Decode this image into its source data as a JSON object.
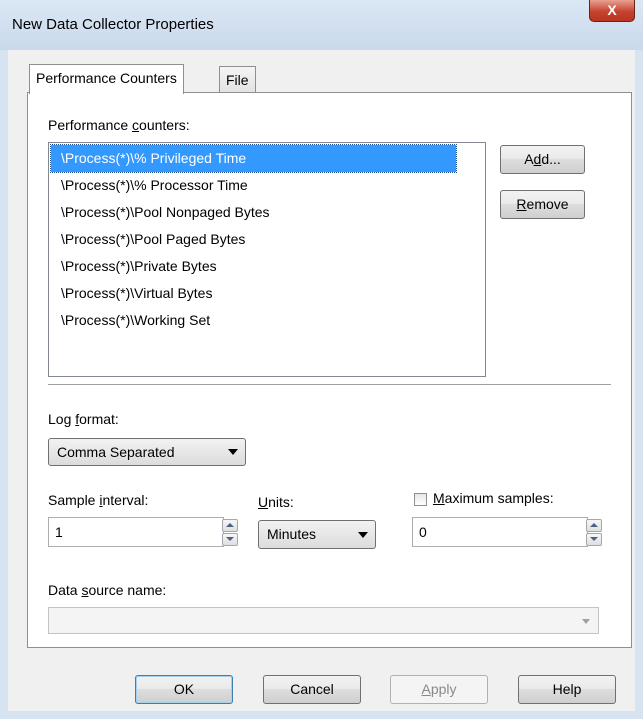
{
  "window": {
    "title": "New Data Collector Properties",
    "close_glyph": "X"
  },
  "tabs": [
    {
      "label": "Performance Counters",
      "active": true
    },
    {
      "label": "File",
      "active": false
    }
  ],
  "counters": {
    "label": "Performance counters:",
    "items": [
      "\\Process(*)\\% Privileged Time",
      "\\Process(*)\\% Processor Time",
      "\\Process(*)\\Pool Nonpaged Bytes",
      "\\Process(*)\\Pool Paged Bytes",
      "\\Process(*)\\Private Bytes",
      "\\Process(*)\\Virtual Bytes",
      "\\Process(*)\\Working Set"
    ],
    "selected_index": 0,
    "add_button": "Add...",
    "remove_button": "Remove"
  },
  "log_format": {
    "label": "Log format:",
    "value": "Comma Separated"
  },
  "sample_interval": {
    "label": "Sample interval:",
    "value": "1"
  },
  "units": {
    "label": "Units:",
    "value": "Minutes"
  },
  "maximum_samples": {
    "label": "Maximum samples:",
    "checked": false,
    "value": "0"
  },
  "data_source": {
    "label": "Data source name:",
    "value": ""
  },
  "footer": {
    "ok": "OK",
    "cancel": "Cancel",
    "apply": "Apply",
    "help": "Help"
  },
  "icons": {
    "close": "close-icon",
    "dropdown": "chevron-down-icon",
    "spin_up": "spin-up-icon",
    "spin_down": "spin-down-icon"
  },
  "colors": {
    "selection": "#3399ff",
    "close_button": "#c6442f",
    "window_frame": "#d6e3f1",
    "client_bg": "#f0f0f0"
  }
}
